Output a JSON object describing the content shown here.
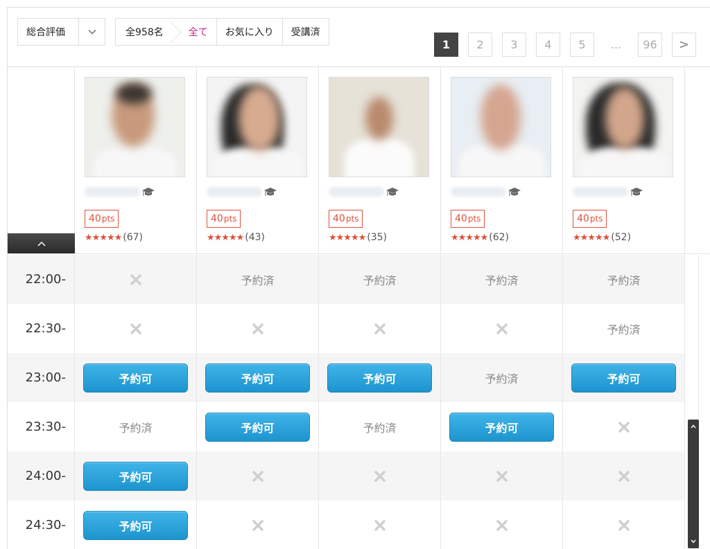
{
  "toolbar": {
    "sort_label": "総合評価",
    "filters": {
      "count": "全958名",
      "all": "全て",
      "favorites": "お気に入り",
      "attended": "受講済"
    },
    "pages": [
      "1",
      "2",
      "3",
      "4",
      "5",
      "...",
      "96"
    ],
    "next": ">"
  },
  "tutors": [
    {
      "points": "40",
      "unit": "pts",
      "stars": "★★★★★",
      "reviews": "(67)"
    },
    {
      "points": "40",
      "unit": "pts",
      "stars": "★★★★★",
      "reviews": "(43)"
    },
    {
      "points": "40",
      "unit": "pts",
      "stars": "★★★★★",
      "reviews": "(35)"
    },
    {
      "points": "40",
      "unit": "pts",
      "stars": "★★★★★",
      "reviews": "(62)"
    },
    {
      "points": "40",
      "unit": "pts",
      "stars": "★★★★★",
      "reviews": "(52)"
    }
  ],
  "status_labels": {
    "available": "予約可",
    "booked": "予約済"
  },
  "schedule": [
    {
      "time": "22:00-",
      "slots": [
        "x",
        "booked",
        "booked",
        "booked",
        "booked"
      ]
    },
    {
      "time": "22:30-",
      "slots": [
        "x",
        "x",
        "x",
        "x",
        "booked"
      ]
    },
    {
      "time": "23:00-",
      "slots": [
        "available",
        "available",
        "available",
        "booked",
        "available"
      ]
    },
    {
      "time": "23:30-",
      "slots": [
        "booked",
        "available",
        "booked",
        "available",
        "x"
      ]
    },
    {
      "time": "24:00-",
      "slots": [
        "available",
        "x",
        "x",
        "x",
        "x"
      ]
    },
    {
      "time": "24:30-",
      "slots": [
        "available",
        "x",
        "x",
        "x",
        "x"
      ]
    }
  ],
  "colors": {
    "accent_pink": "#c8208e",
    "points_red": "#e0503a",
    "button_blue": "#1e94cf"
  }
}
